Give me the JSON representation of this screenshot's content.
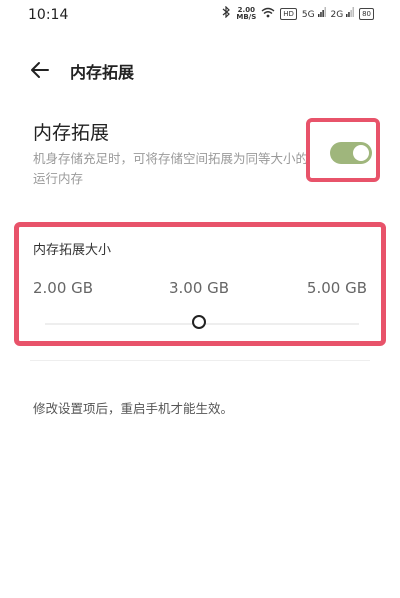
{
  "status_bar": {
    "time": "10:14",
    "speed_top": "2.00",
    "speed_unit": "MB/S",
    "hd": "HD",
    "sig1": "5G",
    "sig2": "2G",
    "battery": "80"
  },
  "header": {
    "title": "内存拓展"
  },
  "memory_extension": {
    "title": "内存拓展",
    "description": "机身存储充足时，可将存储空间拓展为同等大小的运行内存",
    "enabled": true
  },
  "extension_size": {
    "title": "内存拓展大小",
    "options": [
      "2.00 GB",
      "3.00 GB",
      "5.00 GB"
    ],
    "selected": "3.00 GB"
  },
  "footer_note": "修改设置项后，重启手机才能生效。",
  "colors": {
    "accent": "#9fb67c",
    "highlight": "#e8536a"
  }
}
